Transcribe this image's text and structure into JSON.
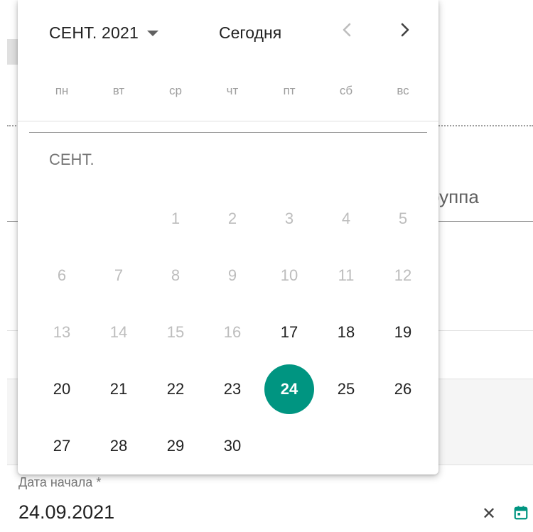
{
  "background": {
    "group_label_partial": "руппа"
  },
  "field": {
    "label": "Дата начала *",
    "value": "24.09.2021",
    "clear_icon": "close-icon",
    "calendar_icon": "calendar-icon"
  },
  "picker": {
    "month_year": "СЕНТ. 2021",
    "today_label": "Сегодня",
    "prev_icon": "chevron-left-icon",
    "next_icon": "chevron-right-icon",
    "weekdays": [
      "пн",
      "вт",
      "ср",
      "чт",
      "пт",
      "сб",
      "вс"
    ],
    "month_label": "СЕНТ.",
    "weeks": [
      [
        "",
        "",
        "1",
        "2",
        "3",
        "4",
        "5"
      ],
      [
        "6",
        "7",
        "8",
        "9",
        "10",
        "11",
        "12"
      ],
      [
        "13",
        "14",
        "15",
        "16",
        "17",
        "18",
        "19"
      ],
      [
        "20",
        "21",
        "22",
        "23",
        "24",
        "25",
        "26"
      ],
      [
        "27",
        "28",
        "29",
        "30",
        "",
        "",
        ""
      ]
    ],
    "first_enabled_day": 17,
    "selected_day": 24,
    "accent_color": "#009581"
  }
}
